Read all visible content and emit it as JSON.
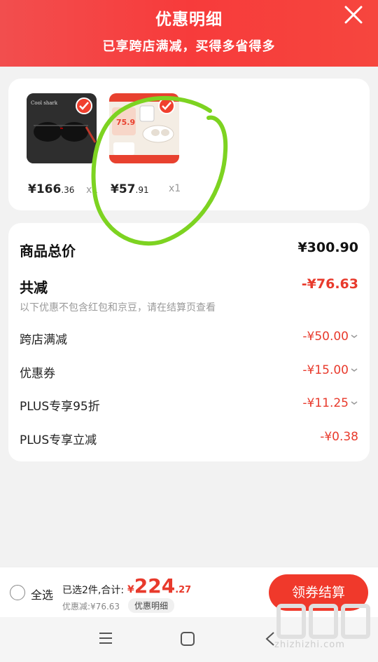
{
  "header": {
    "title": "优惠明细",
    "subtitle": "已享跨店满减，买得多省得多"
  },
  "products": [
    {
      "price_int": "¥166",
      "price_dec": ".36",
      "qty": "x1",
      "selected": true,
      "image": "sunglasses"
    },
    {
      "price_int": "¥57",
      "price_dec": ".91",
      "qty": "x1",
      "selected": true,
      "image": "earphones",
      "promo_label": "75.9"
    }
  ],
  "summary": {
    "total_label": "商品总价",
    "total_value": "¥300.90",
    "discount_label": "共减",
    "discount_value": "-¥76.63",
    "note": "以下优惠不包含红包和京豆，请在结算页查看",
    "items": [
      {
        "label": "跨店满减",
        "value": "-¥50.00",
        "expandable": true
      },
      {
        "label": "优惠券",
        "value": "-¥15.00",
        "expandable": true
      },
      {
        "label": "PLUS专享95折",
        "value": "-¥11.25",
        "expandable": true
      },
      {
        "label": "PLUS专享立减",
        "value": "-¥0.38",
        "expandable": false
      }
    ]
  },
  "bottom_bar": {
    "select_all": "全选",
    "selected_text": "已选2件,合计:",
    "total_yen": "¥",
    "total_int": "224",
    "total_dec": ".27",
    "saved": "优惠减:¥76.63",
    "detail_button": "优惠明细",
    "checkout_button": "领券结算"
  },
  "watermark": {
    "text": "zhizhizhi.com"
  },
  "colors": {
    "header": "#f73b3b",
    "accent_red": "#e83a2c",
    "annotation_green": "#7dd321"
  }
}
